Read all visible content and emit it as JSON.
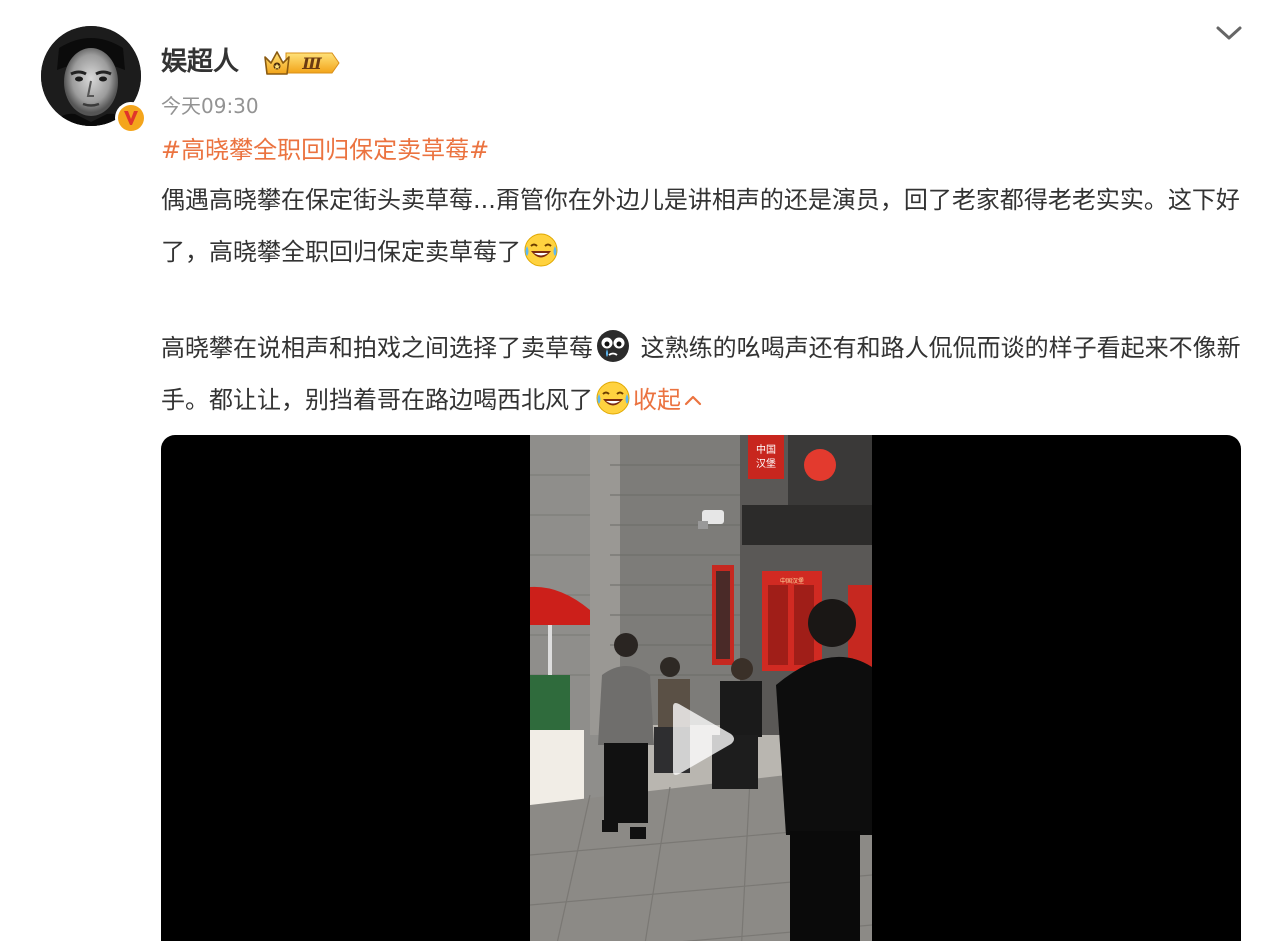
{
  "post": {
    "author": "娱超人",
    "membership_level": "Ⅲ",
    "time": "今天09:30",
    "hashtag": "#高晓攀全职回归保定卖草莓#",
    "para1": "偶遇高晓攀在保定街头卖草莓...甭管你在外边儿是讲相声的还是演员，回了老家都得老老实实。这下好了，高晓攀全职回归保定卖草莓了",
    "para2a": "高晓攀在说相声和拍戏之间选择了卖草莓",
    "para2b": " 这熟练的吆喝声还有和路人侃侃而谈的样子看起来不像新手。都让让，别挡着哥在路边喝西北风了",
    "collapse_label": "收起",
    "shop_sign_text": "中国汉堡"
  },
  "icons": {
    "menu": "chevron-down-icon",
    "verified": "verified-v-icon",
    "crown": "crown-icon",
    "emoji_laugh_cry": "laugh-cry-emoji",
    "emoji_sad": "sad-face-emoji",
    "play": "play-icon"
  },
  "colors": {
    "accent_orange": "#eb7340",
    "text_main": "#333333",
    "text_muted": "#939393",
    "gold": "#f4b323",
    "video_bg": "#000000"
  }
}
